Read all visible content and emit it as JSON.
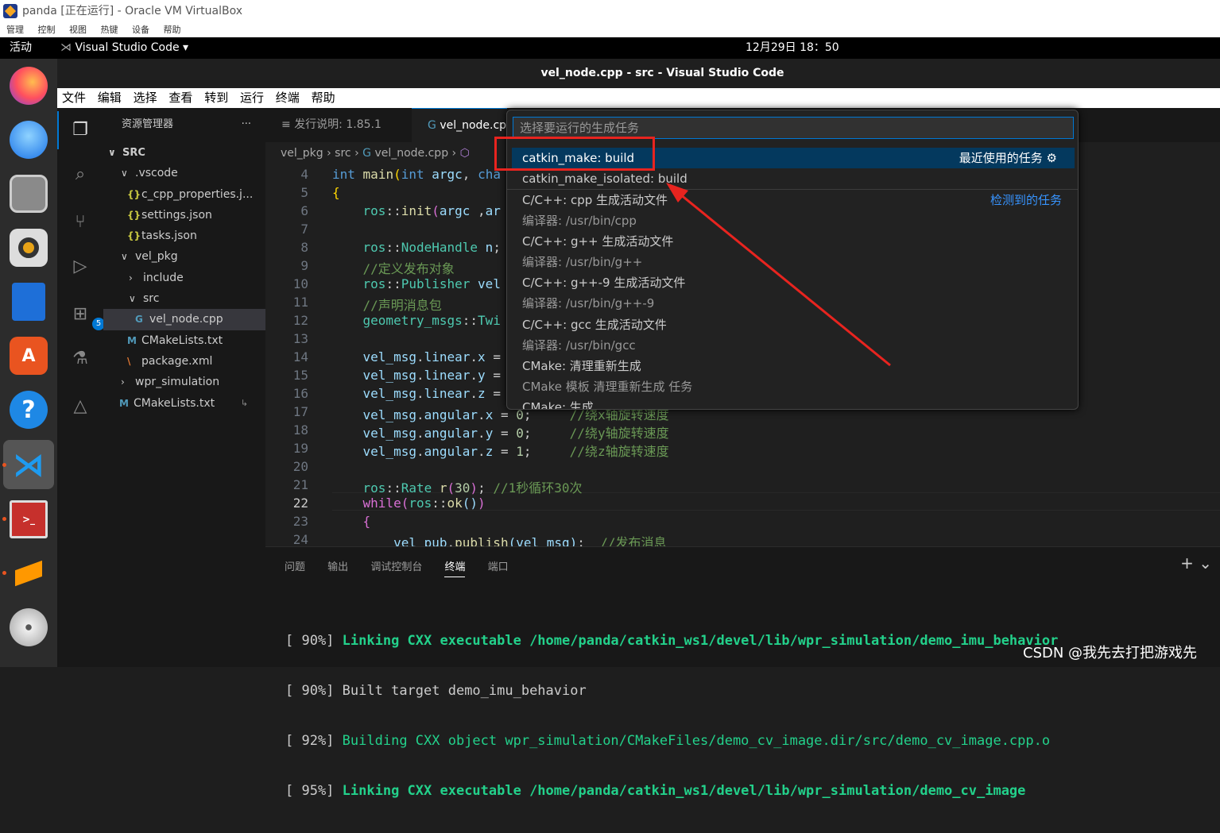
{
  "virtualbox": {
    "title": "panda [正在运行] - Oracle VM VirtualBox",
    "menu": [
      "管理",
      "控制",
      "视图",
      "热键",
      "设备",
      "帮助"
    ]
  },
  "gnome": {
    "activities": "活动",
    "app_name": "Visual Studio Code",
    "clock": "12月29日  18：50"
  },
  "dock": [
    "firefox-icon",
    "thunderbird-icon",
    "files-icon",
    "rhythmbox-icon",
    "writer-icon",
    "app-center-icon",
    "help-icon",
    "vscode-icon",
    "terminal-icon",
    "sublime-icon",
    "dvd-icon"
  ],
  "vscode": {
    "window_title": "vel_node.cpp - src - Visual Studio Code",
    "menu": [
      "文件",
      "编辑",
      "选择",
      "查看",
      "转到",
      "运行",
      "终端",
      "帮助"
    ],
    "extensions_badge": "5"
  },
  "sidebar": {
    "title": "资源管理器",
    "more": "···",
    "items": [
      {
        "label": "SRC",
        "caret": "∨"
      },
      {
        "label": ".vscode",
        "caret": "∨"
      },
      {
        "label": "c_cpp_properties.j...",
        "icon": "{}"
      },
      {
        "label": "settings.json",
        "icon": "{}"
      },
      {
        "label": "tasks.json",
        "icon": "{}"
      },
      {
        "label": "vel_pkg",
        "caret": "∨"
      },
      {
        "label": "include",
        "caret": "›"
      },
      {
        "label": "src",
        "caret": "∨"
      },
      {
        "label": "vel_node.cpp",
        "icon": "G"
      },
      {
        "label": "CMakeLists.txt",
        "icon": "M"
      },
      {
        "label": "package.xml",
        "icon": "\\"
      },
      {
        "label": "wpr_simulation",
        "caret": "›"
      },
      {
        "label": "CMakeLists.txt",
        "icon": "M"
      }
    ]
  },
  "tabs": [
    {
      "label": "发行说明: 1.85.1"
    },
    {
      "label": "vel_node.cp"
    }
  ],
  "breadcrumb": [
    "vel_pkg",
    "src",
    "vel_node.cpp"
  ],
  "editor": {
    "line_numbers": [
      "4",
      "5",
      "6",
      "7",
      "8",
      "9",
      "10",
      "11",
      "12",
      "13",
      "14",
      "15",
      "16",
      "17",
      "18",
      "19",
      "20",
      "21",
      "22",
      "23",
      "24"
    ],
    "current_line": "22"
  },
  "panel": {
    "tabs": [
      "问题",
      "输出",
      "调试控制台",
      "终端",
      "端口"
    ],
    "active_tab": "终端",
    "terminal_lines": [
      {
        "pct": "[ 90%]",
        "text": "Linking CXX executable /home/panda/catkin_ws1/devel/lib/wpr_simulation/demo_imu_behavior",
        "style": "bold"
      },
      {
        "pct": "[ 90%]",
        "text": "Built target demo_imu_behavior",
        "style": "plain"
      },
      {
        "pct": "[ 92%]",
        "text": "Building CXX object wpr_simulation/CMakeFiles/demo_cv_image.dir/src/demo_cv_image.cpp.o",
        "style": "green"
      },
      {
        "pct": "[ 95%]",
        "text": "Linking CXX executable /home/panda/catkin_ws1/devel/lib/wpr_simulation/demo_cv_image",
        "style": "bold"
      }
    ]
  },
  "quick_pick": {
    "placeholder": "选择要运行的生成任务",
    "recent_label": "最近使用的任务",
    "detected_label": "检测到的任务",
    "items": [
      "catkin_make: build",
      "catkin_make_isolated: build",
      "C/C++: cpp 生成活动文件",
      "编译器: /usr/bin/cpp",
      "C/C++: g++ 生成活动文件",
      "编译器: /usr/bin/g++",
      "C/C++: g++-9 生成活动文件",
      "编译器: /usr/bin/g++-9",
      "C/C++: gcc 生成活动文件",
      "编译器: /usr/bin/gcc",
      "CMake: 清理重新生成",
      "CMake 模板 清理重新生成 任务",
      "CMake: 生成"
    ]
  },
  "watermark": "CSDN @我先去打把游戏先",
  "colors": {
    "accent": "#0078d4",
    "annotation": "#e8241f",
    "terminal_green": "#23d18b"
  }
}
